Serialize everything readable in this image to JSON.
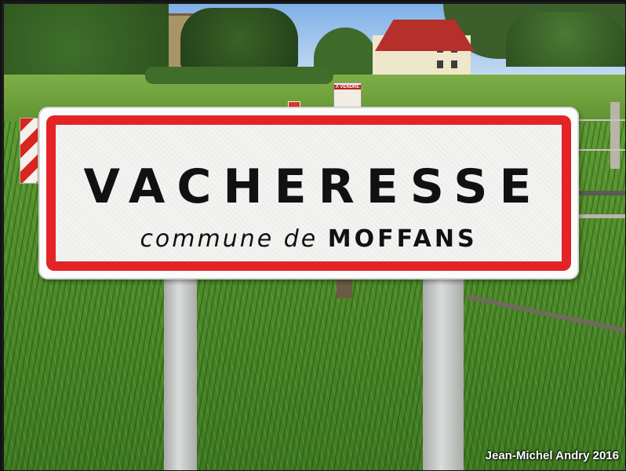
{
  "sign": {
    "title": "VACHERESSE",
    "subtitle_lower": "commune de",
    "subtitle_upper": "MOFFANS",
    "border_color": "#e32326",
    "background_color": "#f3f3f1",
    "text_color": "#111111"
  },
  "small_sign": {
    "text": "A VENDRE"
  },
  "credit": "Jean-Michel Andry 2016"
}
